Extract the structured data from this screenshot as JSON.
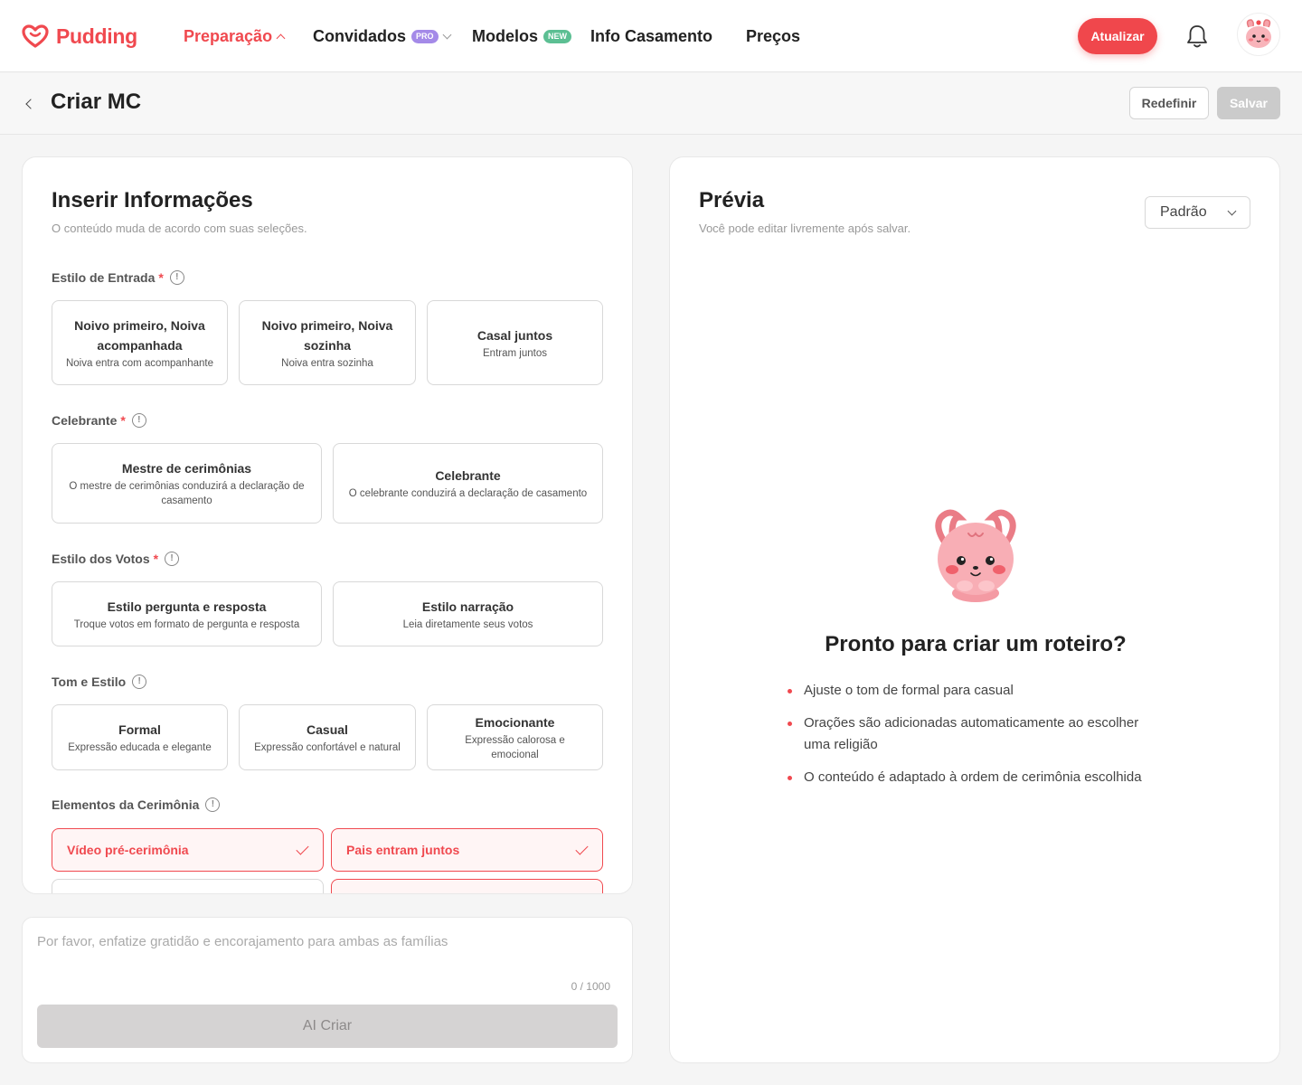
{
  "brand": {
    "name": "Pudding",
    "accent": "#f0494f"
  },
  "nav": {
    "items": [
      {
        "label": "Preparação",
        "active": true
      },
      {
        "label": "Convidados",
        "badge": "PRO"
      },
      {
        "label": "Modelos",
        "badge": "NEW"
      },
      {
        "label": "Info Casamento"
      },
      {
        "label": "Preços"
      }
    ],
    "upgrade_label": "Atualizar",
    "bell_icon": "bell-icon",
    "avatar_icon": "pink-bunny-avatar"
  },
  "page": {
    "title": "Criar MC",
    "reset_label": "Redefinir",
    "save_label": "Salvar"
  },
  "form": {
    "title": "Inserir Informações",
    "subtitle": "O conteúdo muda de acordo com suas seleções.",
    "sections": [
      {
        "label": "Estilo de Entrada",
        "required": "*",
        "options": [
          {
            "title": "Noivo primeiro, Noiva acompanhada",
            "desc": "Noiva entra com acompanhante"
          },
          {
            "title": "Noivo primeiro, Noiva sozinha",
            "desc": "Noiva entra sozinha"
          },
          {
            "title": "Casal juntos",
            "desc": "Entram juntos"
          }
        ]
      },
      {
        "label": "Celebrante",
        "required": "*",
        "options": [
          {
            "title": "Mestre de cerimônias",
            "desc": "O mestre de cerimônias conduzirá a declaração de casamento"
          },
          {
            "title": "Celebrante",
            "desc": "O celebrante conduzirá a declaração de casamento"
          }
        ]
      },
      {
        "label": "Estilo dos Votos",
        "required": "*",
        "options": [
          {
            "title": "Estilo pergunta e resposta",
            "desc": "Troque votos em formato de pergunta e resposta"
          },
          {
            "title": "Estilo narração",
            "desc": "Leia diretamente seus votos"
          }
        ]
      },
      {
        "label": "Tom e Estilo",
        "options": [
          {
            "title": "Formal",
            "desc": "Expressão educada e elegante"
          },
          {
            "title": "Casual",
            "desc": "Expressão confortável e natural"
          },
          {
            "title": "Emocionante",
            "desc": "Expressão calorosa e emocional"
          }
        ]
      },
      {
        "label": "Elementos da Cerimônia",
        "chips": [
          {
            "label": "Vídeo pré-cerimônia",
            "selected": true
          },
          {
            "label": "Pais entram juntos",
            "selected": true
          }
        ]
      }
    ]
  },
  "prompt": {
    "placeholder": "Por favor, enfatize gratidão e encorajamento para ambas as famílias",
    "counter": "0 / 1000",
    "button_label": "AI Criar"
  },
  "preview": {
    "title": "Prévia",
    "subtitle": "Você pode editar livremente após salvar.",
    "style_value": "Padrão",
    "ready_title": "Pronto para criar um roteiro?",
    "tips": [
      "Ajuste o tom de formal para casual",
      "Orações são adicionadas automaticamente ao escolher uma religião",
      "O conteúdo é adaptado à ordem de cerimônia escolhida"
    ]
  }
}
